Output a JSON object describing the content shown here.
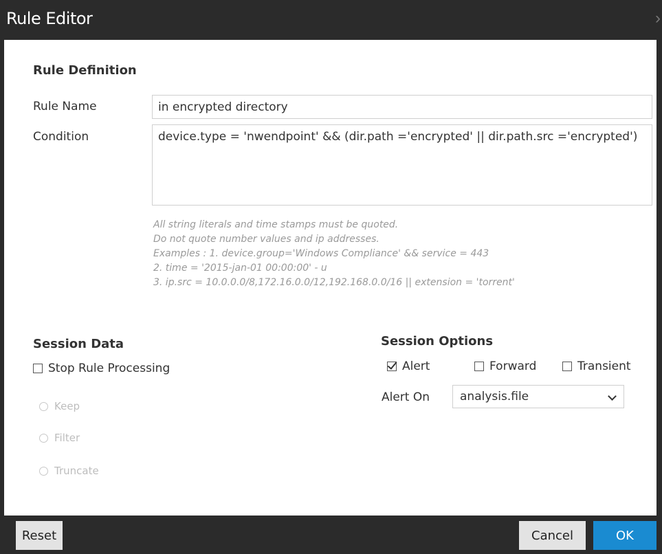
{
  "window": {
    "title": "Rule Editor",
    "close_icon": "close-icon"
  },
  "rule_definition": {
    "heading": "Rule Definition",
    "rule_name_label": "Rule Name",
    "rule_name_value": "in encrypted directory",
    "condition_label": "Condition",
    "condition_value": "device.type = 'nwendpoint' && (dir.path ='encrypted' || dir.path.src ='encrypted')",
    "hints": [
      "All string literals and time stamps must be quoted.",
      "Do not quote number values and ip addresses.",
      "Examples : 1. device.group='Windows Compliance' && service = 443",
      "2. time = '2015-jan-01 00:00:00' - u",
      "3. ip.src = 10.0.0.0/8,172.16.0.0/12,192.168.0.0/16 || extension = 'torrent'"
    ]
  },
  "session_data": {
    "heading": "Session Data",
    "stop_processing_label": "Stop Rule Processing",
    "stop_processing_checked": false,
    "radios": [
      {
        "label": "Keep",
        "selected": false,
        "disabled": true
      },
      {
        "label": "Filter",
        "selected": false,
        "disabled": true
      },
      {
        "label": "Truncate",
        "selected": false,
        "disabled": true
      }
    ]
  },
  "session_options": {
    "heading": "Session Options",
    "alert_label": "Alert",
    "alert_checked": true,
    "forward_label": "Forward",
    "forward_checked": false,
    "transient_label": "Transient",
    "transient_checked": false,
    "alert_on_label": "Alert On",
    "alert_on_value": "analysis.file"
  },
  "footer": {
    "reset_label": "Reset",
    "cancel_label": "Cancel",
    "ok_label": "OK"
  },
  "colors": {
    "titlebar": "#2b2b2b",
    "primary_button": "#1a8bd1",
    "secondary_button": "#e3e3e3",
    "hint_text": "#9a9a9a"
  }
}
